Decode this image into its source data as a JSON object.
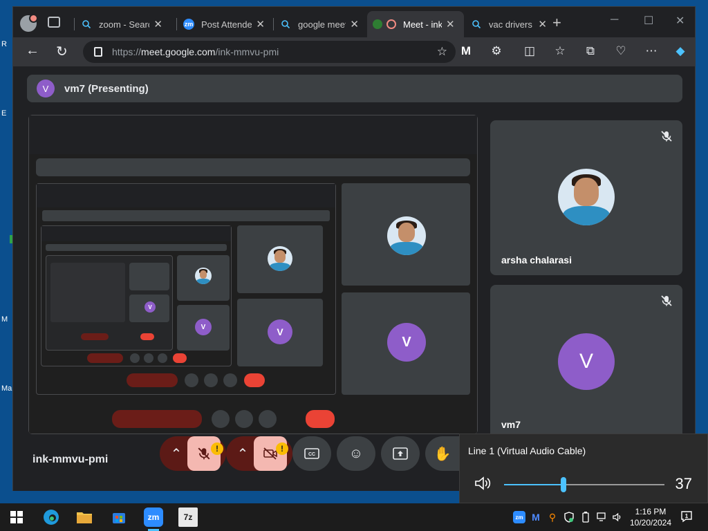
{
  "desktop": {
    "fragments": [
      "R",
      "E",
      "M",
      "Ma"
    ]
  },
  "browser": {
    "tabs": [
      {
        "title": "zoom - Search",
        "icon": "search-icon",
        "active": false
      },
      {
        "title": "Post Attendee",
        "icon": "zoom-icon",
        "active": false
      },
      {
        "title": "google meet",
        "icon": "search-icon",
        "active": false
      },
      {
        "title": "Meet - ink-mmvu-pmi",
        "icon": "meet-icon",
        "active": true
      },
      {
        "title": "vac drivers - Search",
        "icon": "search-icon",
        "active": false
      }
    ],
    "zoom_logo_text": "zm",
    "url_prefix": "https://",
    "url_host": "meet.google.com",
    "url_path": "/ink-mmvu-pmi"
  },
  "meet": {
    "presenter_initial": "V",
    "presenter_label": "vm7 (Presenting)",
    "participants": [
      {
        "name": "arsha chalarasi",
        "type": "video",
        "muted": true
      },
      {
        "name": "vm7",
        "type": "avatar",
        "initial": "V",
        "muted": true
      }
    ],
    "meeting_code": "ink-mmvu-pmi",
    "warning_symbol": "!",
    "participant_count": "3",
    "colors": {
      "accent": "#8e5dc9",
      "end_call": "#ea4335",
      "warning": "#fbbc04",
      "mic_off_bg": "#f4b8b1"
    }
  },
  "volume": {
    "device": "Line 1 (Virtual Audio Cable)",
    "level": 37
  },
  "taskbar": {
    "time": "1:16 PM",
    "date": "10/20/2024",
    "zoom_text": "zm",
    "sevenzip_text": "7z",
    "notification_count": "1"
  }
}
